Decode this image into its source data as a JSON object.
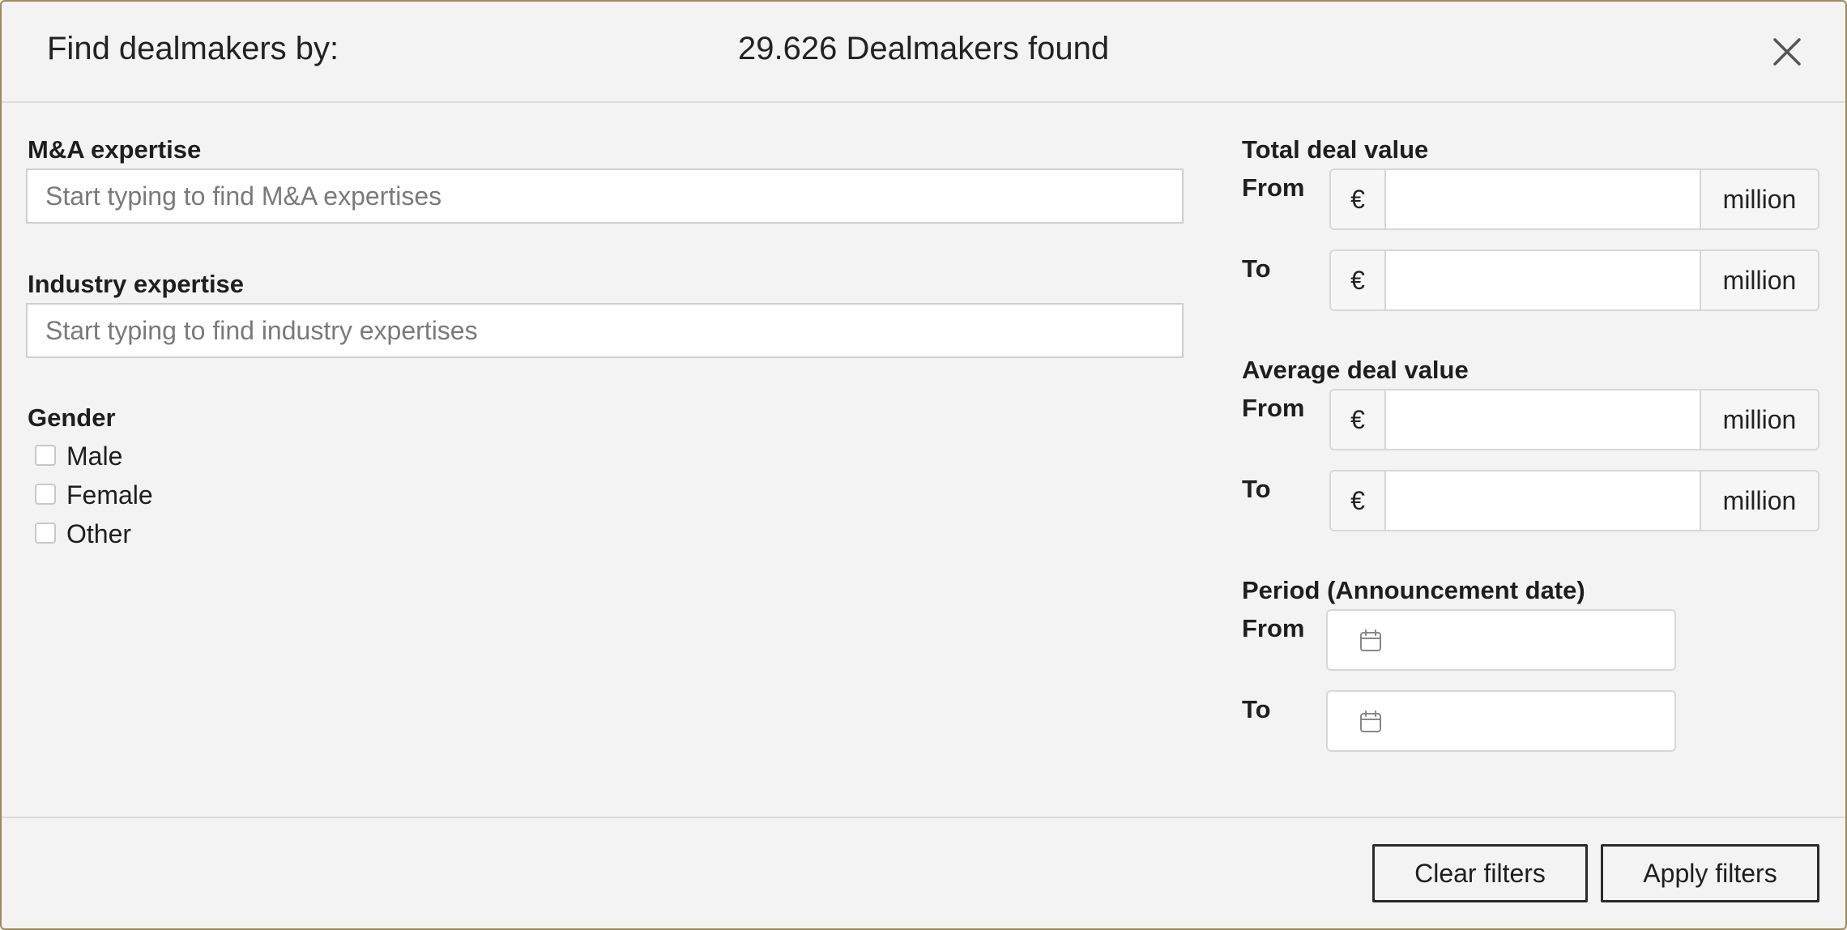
{
  "header": {
    "title": "Find dealmakers by:",
    "result_count": "29.626 Dealmakers found",
    "close_icon": "close-icon"
  },
  "left": {
    "ma_expertise": {
      "label": "M&A expertise",
      "placeholder": "Start typing to find M&A expertises",
      "value": ""
    },
    "industry_expertise": {
      "label": "Industry expertise",
      "placeholder": "Start typing to find industry expertises",
      "value": ""
    },
    "gender": {
      "label": "Gender",
      "options": [
        {
          "label": "Male",
          "checked": false
        },
        {
          "label": "Female",
          "checked": false
        },
        {
          "label": "Other",
          "checked": false
        }
      ]
    }
  },
  "right": {
    "total_deal_value": {
      "label": "Total deal value",
      "from_label": "From",
      "to_label": "To",
      "currency": "€",
      "unit": "million",
      "from_value": "",
      "to_value": ""
    },
    "average_deal_value": {
      "label": "Average deal value",
      "from_label": "From",
      "to_label": "To",
      "currency": "€",
      "unit": "million",
      "from_value": "",
      "to_value": ""
    },
    "period": {
      "label": "Period (Announcement date)",
      "from_label": "From",
      "to_label": "To",
      "icon": "calendar-icon",
      "from_value": "",
      "to_value": ""
    }
  },
  "footer": {
    "clear_label": "Clear filters",
    "apply_label": "Apply filters"
  },
  "colors": {
    "background": "#f3f3f3",
    "frame_border": "#a08a55",
    "button_border": "#2a2a2a"
  }
}
